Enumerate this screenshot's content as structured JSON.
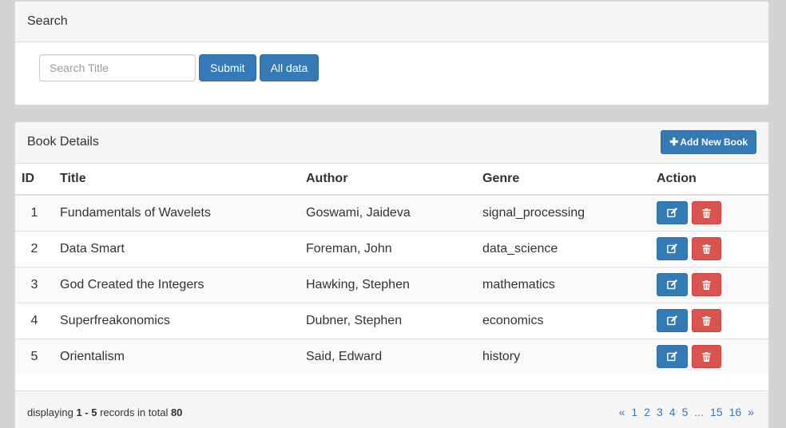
{
  "search": {
    "heading": "Search",
    "placeholder": "Search Title",
    "value": "",
    "submit_label": "Submit",
    "all_label": "All data"
  },
  "books": {
    "heading": "Book Details",
    "add_label": "Add New Book",
    "columns": [
      "ID",
      "Title",
      "Author",
      "Genre",
      "Action"
    ],
    "rows": [
      {
        "id": "1",
        "title": "Fundamentals of Wavelets",
        "author": "Goswami, Jaideva",
        "genre": "signal_processing"
      },
      {
        "id": "2",
        "title": "Data Smart",
        "author": "Foreman, John",
        "genre": "data_science"
      },
      {
        "id": "3",
        "title": "God Created the Integers",
        "author": "Hawking, Stephen",
        "genre": "mathematics"
      },
      {
        "id": "4",
        "title": "Superfreakonomics",
        "author": "Dubner, Stephen",
        "genre": "economics"
      },
      {
        "id": "5",
        "title": "Orientalism",
        "author": "Said, Edward",
        "genre": "history"
      }
    ]
  },
  "footer": {
    "prefix": "displaying ",
    "range": "1 - 5",
    "middle": " records in total ",
    "total": "80"
  },
  "pagination": [
    "«",
    "1",
    "2",
    "3",
    "4",
    "5",
    "...",
    "15",
    "16",
    "»"
  ],
  "colors": {
    "primary": "#337ab7",
    "danger": "#d9534f",
    "background": "#d4d4d4"
  },
  "icons": {
    "edit": "edit-icon",
    "delete": "trash-icon",
    "add": "plus-icon"
  }
}
